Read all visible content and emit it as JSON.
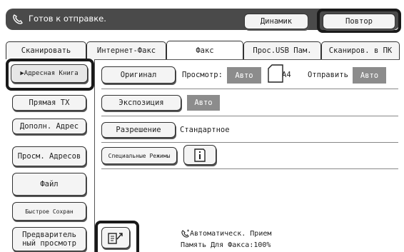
{
  "status": {
    "text": "Готов к отправке."
  },
  "top_buttons": {
    "dynamic": "Динамик",
    "repeat": "Повтор"
  },
  "tabs": [
    "Сканировать",
    "Интернет-Факс",
    "Факс",
    "Прос.USB Пам.",
    "Сканиров. в ПК"
  ],
  "left_buttons": {
    "address_book": "▶Адресная Книга",
    "direct_tx": "Прямая TX",
    "additional_address": "Дополн. Адрес",
    "view_addresses": "Просм. Адресов",
    "file": "Файл",
    "quick_save": "Быстрое Сохран",
    "preview_line1": "Предваритель",
    "preview_line2": "ный просмотр"
  },
  "settings": {
    "original_button": "Оригинал",
    "preview_label": "Просмотр:",
    "preview_value": "Авто",
    "paper_size": "A4",
    "send_label": "Отправить",
    "send_value": "Авто",
    "exposure_button": "Экспозиция",
    "exposure_value": "Авто",
    "resolution_button": "Разрешение",
    "resolution_value": "Стандартное",
    "special_modes_button": "Специальные Режимы"
  },
  "footer": {
    "auto_receive": "Автоматическ. Прием",
    "fax_memory": "Память Для Факса:100%"
  }
}
